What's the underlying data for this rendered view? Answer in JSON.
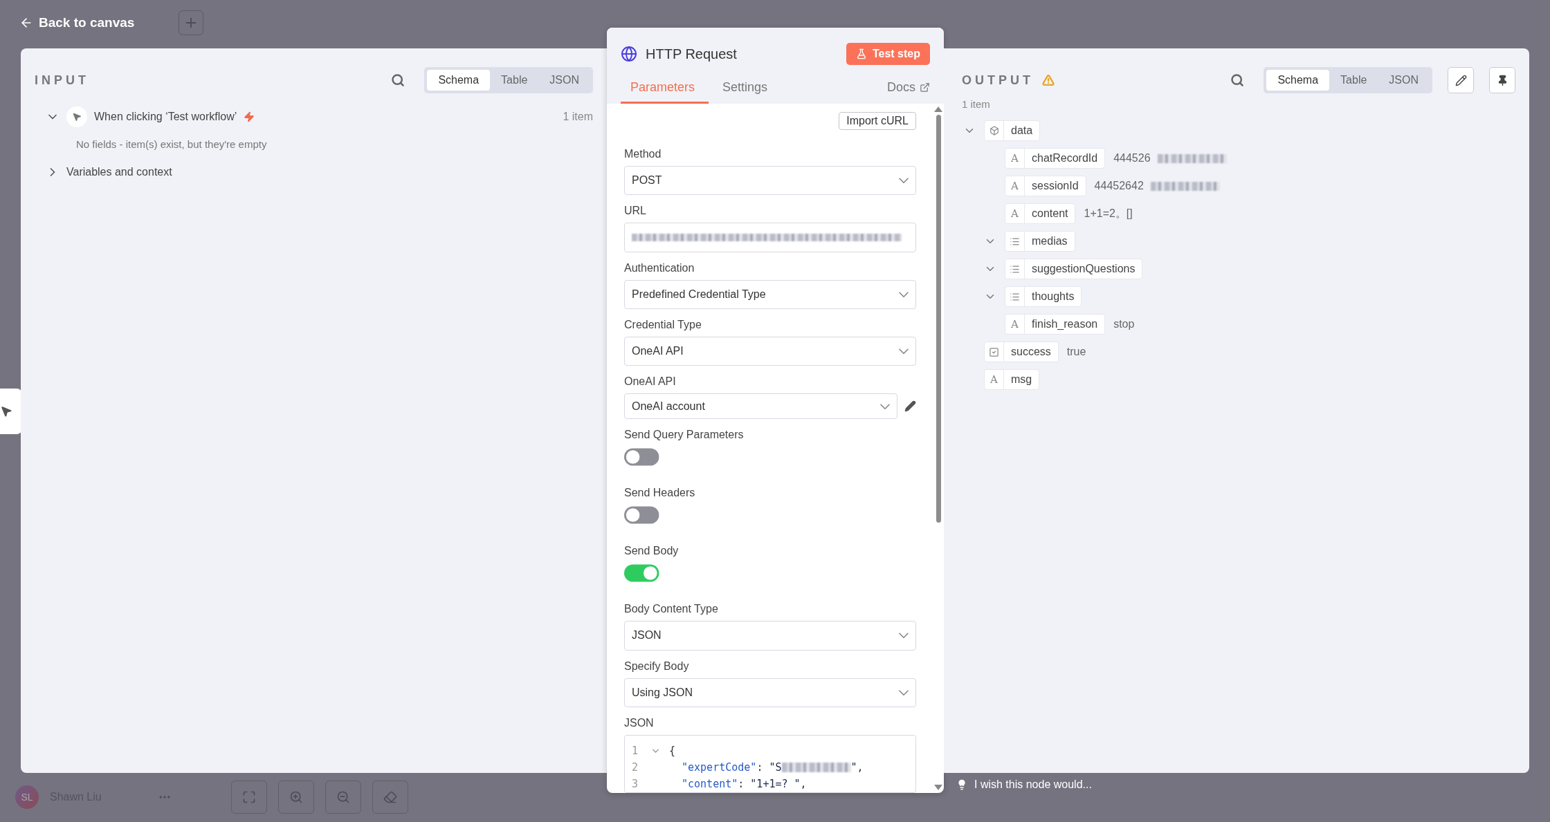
{
  "back_link": "Back to canvas",
  "input": {
    "title": "INPUT",
    "views": [
      {
        "label": "Schema",
        "selected": true
      },
      {
        "label": "Table",
        "selected": false
      },
      {
        "label": "JSON",
        "selected": false
      }
    ],
    "trigger": {
      "label": "When clicking ‘Test workflow’",
      "count": "1 item",
      "expanded": true,
      "message": "No fields - item(s) exist, but they're empty"
    },
    "variables": {
      "label": "Variables and context",
      "expanded": false
    }
  },
  "node": {
    "title": "HTTP Request",
    "test_button": "Test step",
    "tabs": [
      {
        "label": "Parameters",
        "selected": true
      },
      {
        "label": "Settings",
        "selected": false
      }
    ],
    "docs": "Docs",
    "import_button": "Import cURL",
    "params": [
      {
        "kind": "select",
        "label": "Method",
        "value": "POST"
      },
      {
        "kind": "redacted",
        "label": "URL"
      },
      {
        "kind": "select",
        "label": "Authentication",
        "value": "Predefined Credential Type"
      },
      {
        "kind": "select",
        "label": "Credential Type",
        "value": "OneAI API"
      },
      {
        "kind": "credential",
        "label": "OneAI API",
        "value": "OneAI account"
      },
      {
        "kind": "toggle",
        "label": "Send Query Parameters",
        "on": false
      },
      {
        "kind": "toggle",
        "label": "Send Headers",
        "on": false
      },
      {
        "kind": "toggle",
        "label": "Send Body",
        "on": true
      },
      {
        "kind": "select",
        "label": "Body Content Type",
        "value": "JSON"
      },
      {
        "kind": "select",
        "label": "Specify Body",
        "value": "Using JSON"
      },
      {
        "kind": "code",
        "label": "JSON",
        "lines": [
          {
            "num": "1",
            "fold": true,
            "tokens": [
              {
                "kind": "punct",
                "text": "{"
              }
            ]
          },
          {
            "num": "2",
            "fold": false,
            "tokens": [
              {
                "kind": "key",
                "text": "\"expertCode\""
              },
              {
                "kind": "punct",
                "text": ": "
              },
              {
                "kind": "string",
                "text": "\"S"
              },
              {
                "kind": "redacted"
              },
              {
                "kind": "string",
                "text": "\""
              },
              {
                "kind": "punct",
                "text": ","
              }
            ]
          },
          {
            "num": "3",
            "fold": false,
            "tokens": [
              {
                "kind": "key",
                "text": "\"content\""
              },
              {
                "kind": "punct",
                "text": ": "
              },
              {
                "kind": "string",
                "text": "\"1+1=? \""
              },
              {
                "kind": "punct",
                "text": ","
              }
            ]
          }
        ]
      }
    ]
  },
  "output": {
    "title": "OUTPUT",
    "warning": true,
    "views": [
      {
        "label": "Schema",
        "selected": true
      },
      {
        "label": "Table",
        "selected": false
      },
      {
        "label": "JSON",
        "selected": false
      }
    ],
    "count": "1 item",
    "tree": [
      {
        "name": "data",
        "kind": "object",
        "expanded": true,
        "children": [
          {
            "name": "chatRecordId",
            "kind": "string",
            "icon": "A",
            "value": "444526",
            "redacted": true
          },
          {
            "name": "sessionId",
            "kind": "string",
            "icon": "A",
            "value": "44452642",
            "redacted": true
          },
          {
            "name": "content",
            "kind": "string",
            "icon": "A",
            "value": "1+1=2。[]",
            "redacted": false
          },
          {
            "name": "medias",
            "kind": "array",
            "expanded": true
          },
          {
            "name": "suggestionQuestions",
            "kind": "array",
            "expanded": true
          },
          {
            "name": "thoughts",
            "kind": "array",
            "expanded": true
          },
          {
            "name": "finish_reason",
            "kind": "string",
            "icon": "A",
            "value": "stop",
            "redacted": false
          }
        ]
      },
      {
        "name": "success",
        "kind": "boolean",
        "value": "true",
        "redacted": false
      },
      {
        "name": "msg",
        "kind": "string",
        "icon": "A"
      }
    ]
  },
  "footer": {
    "user": {
      "initials": "SL",
      "name": "Shawn Liu"
    },
    "feedback": "I wish this node would..."
  }
}
